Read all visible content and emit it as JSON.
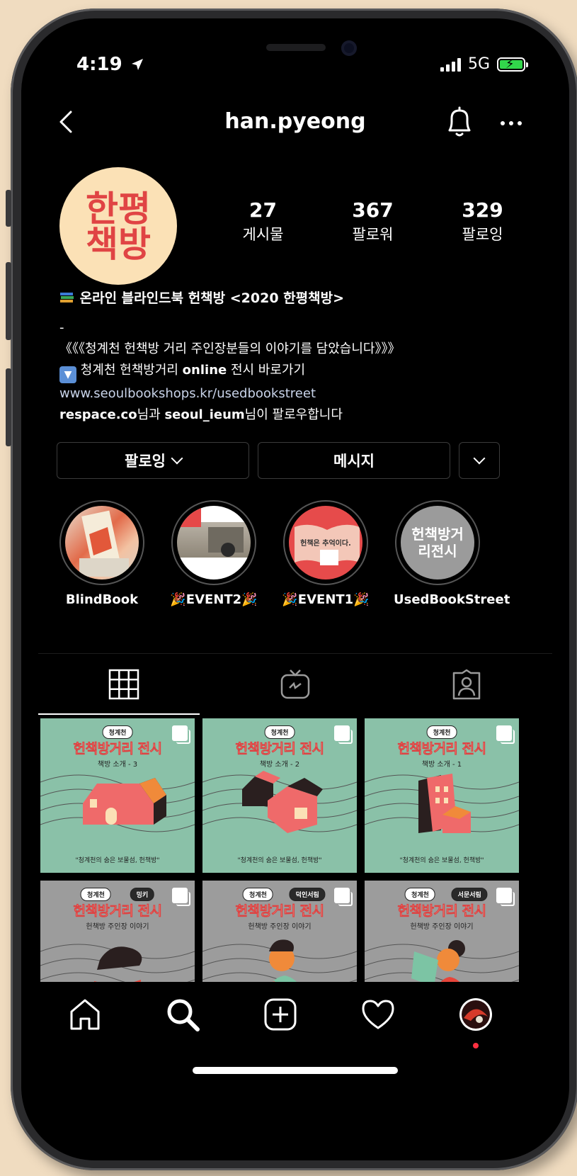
{
  "status_bar": {
    "time": "4:19",
    "network": "5G"
  },
  "header": {
    "username": "han.pyeong"
  },
  "profile": {
    "avatar_line1": "한평",
    "avatar_line2": "책방",
    "stats": [
      {
        "count": "27",
        "label": "게시물"
      },
      {
        "count": "367",
        "label": "팔로워"
      },
      {
        "count": "329",
        "label": "팔로잉"
      }
    ],
    "bio": {
      "line1": "온라인 블라인드북 헌책방 <2020 한평책방>",
      "line2": "-",
      "line3": "《《《청계천 헌책방 거리 주인장분들의 이야기를 담았습니다》》》",
      "line4_pre": "청계천 헌책방거리 ",
      "line4_bold": "online",
      "line4_post": " 전시 바로가기",
      "link": "www.seoulbookshops.kr/usedbookstreet",
      "followed_user1": "respace.co",
      "followed_mid": "님과 ",
      "followed_user2": "seoul_ieum",
      "followed_end": "님이 팔로우합니다"
    }
  },
  "actions": {
    "following_label": "팔로잉",
    "message_label": "메시지"
  },
  "highlights": [
    {
      "name": "BlindBook",
      "cover_text": ""
    },
    {
      "name": "🎉EVENT2🎉",
      "cover_text": ""
    },
    {
      "name": "🎉EVENT1🎉",
      "cover_text": "헌책은 추억이다."
    },
    {
      "name": "UsedBookStreet",
      "cover_text": "헌책방거리전시"
    }
  ],
  "posts": [
    {
      "tag": "청계천",
      "tag2": "",
      "title": "헌책방거리 전시",
      "subtitle": "책방 소개 - 3",
      "footer": "\"청계천의 숨은 보물섬, 헌책방\""
    },
    {
      "tag": "청계천",
      "tag2": "",
      "title": "헌책방거리 전시",
      "subtitle": "책방 소개 - 2",
      "footer": "\"청계천의 숨은 보물섬, 헌책방\""
    },
    {
      "tag": "청계천",
      "tag2": "",
      "title": "헌책방거리 전시",
      "subtitle": "책방 소개 - 1",
      "footer": "\"청계천의 숨은 보물섬, 헌책방\""
    },
    {
      "tag": "청계천",
      "tag2": "밍키",
      "title": "헌책방거리 전시",
      "subtitle": "헌책방 주인장 이야기",
      "footer": ""
    },
    {
      "tag": "청계천",
      "tag2": "덕인서림",
      "title": "헌책방거리 전시",
      "subtitle": "헌책방 주인장 이야기",
      "footer": ""
    },
    {
      "tag": "청계천",
      "tag2": "서문서림",
      "title": "헌책방거리 전시",
      "subtitle": "헌책방 주인장 이야기",
      "footer": ""
    }
  ],
  "colors": {
    "background": "#000000",
    "avatar_bg": "#fbe1b6",
    "avatar_text": "#e04444",
    "post_green": "#8ac1a8",
    "post_grey": "#9c9c9c",
    "battery": "#32d74b",
    "notification_dot": "#ff3040"
  },
  "icons": {
    "topbar": [
      "back-arrow-icon",
      "bell-icon",
      "more-icon"
    ],
    "tabs": [
      "grid-icon",
      "igtv-icon",
      "tagged-icon"
    ],
    "bottom_nav": [
      "home-icon",
      "search-icon",
      "add-icon",
      "heart-icon",
      "profile-avatar-icon"
    ]
  }
}
